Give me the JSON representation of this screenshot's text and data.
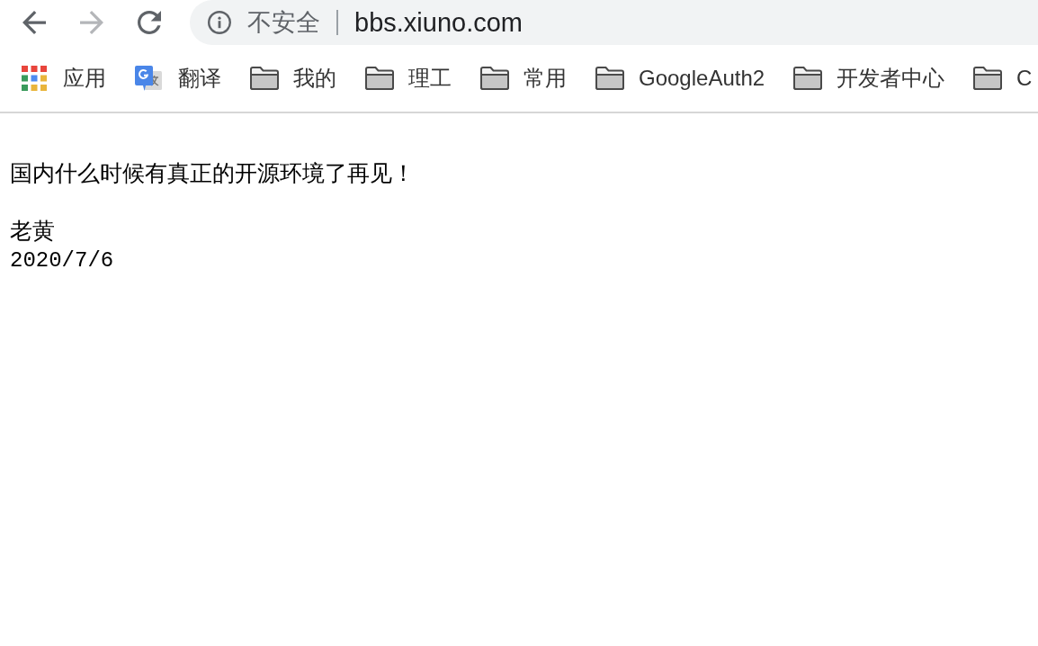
{
  "toolbar": {
    "nav_buttons": [
      {
        "kind": "back",
        "disabled": false
      },
      {
        "kind": "forward",
        "disabled": true
      },
      {
        "kind": "reload",
        "disabled": false
      }
    ],
    "address_bar": {
      "security_label": "不安全",
      "url": "bbs.xiuno.com"
    }
  },
  "bookmarks": [
    {
      "kind": "apps",
      "label": "应用"
    },
    {
      "kind": "translate",
      "label": "翻译"
    },
    {
      "kind": "folder",
      "label": "我的"
    },
    {
      "kind": "folder",
      "label": "理工"
    },
    {
      "kind": "folder",
      "label": "常用"
    },
    {
      "kind": "folder",
      "label": "GoogleAuth2"
    },
    {
      "kind": "folder",
      "label": "开发者中心"
    },
    {
      "kind": "folder",
      "label": "C"
    }
  ],
  "page": {
    "message": "国内什么时候有真正的开源环境了再见！",
    "signature": "老黄",
    "date": "2020/7/6"
  }
}
